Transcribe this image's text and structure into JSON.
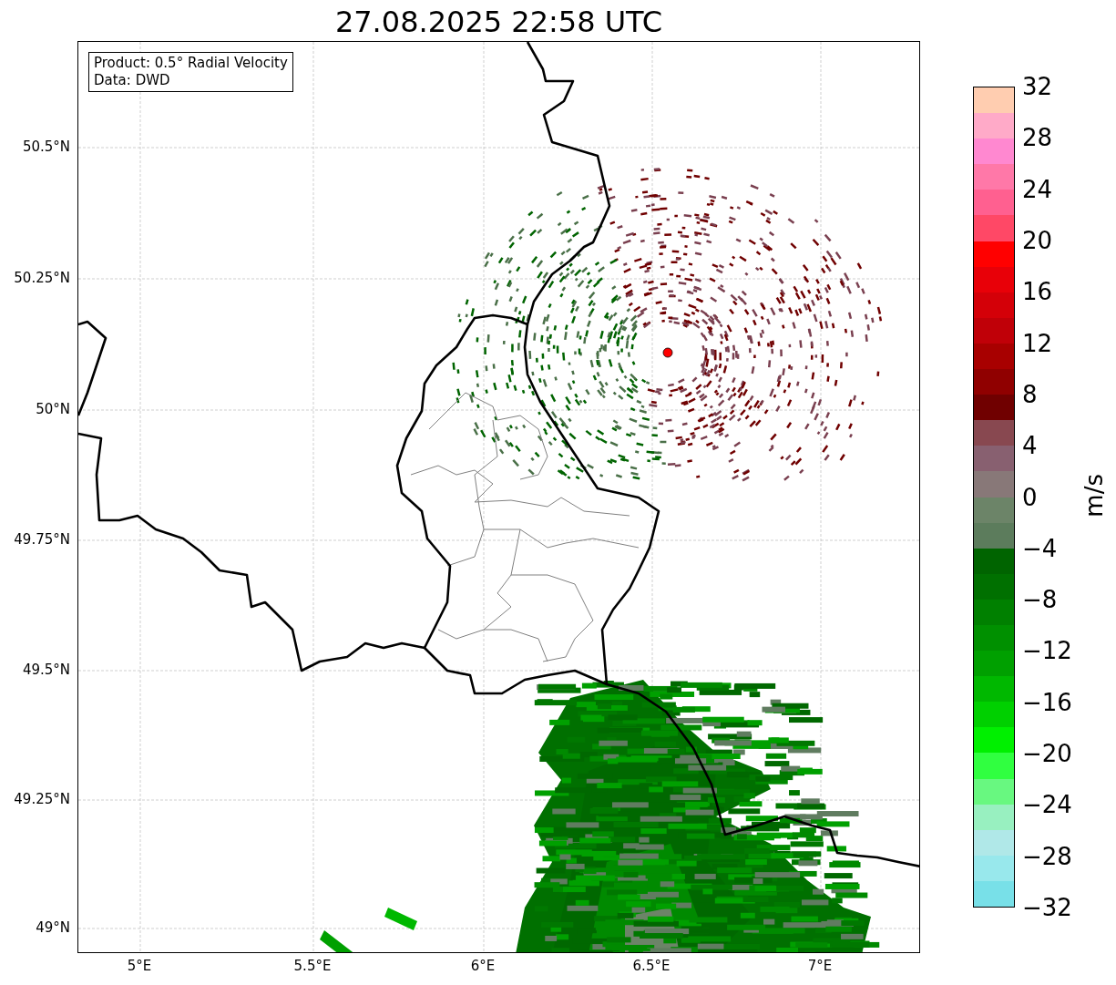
{
  "title": "27.08.2025 22:58 UTC",
  "info_box": {
    "lines": [
      "Product: 0.5° Radial Velocity",
      "Data: DWD"
    ]
  },
  "map": {
    "y_ticks": [
      "50.5°N",
      "50.25°N",
      "50°N",
      "49.75°N",
      "49.5°N",
      "49.25°N",
      "49°N"
    ],
    "x_ticks": [
      "5°E",
      "5.5°E",
      "6°E",
      "6.5°E",
      "7°E"
    ]
  },
  "colorbar": {
    "label": "m/s",
    "ticks": [
      "32",
      "28",
      "24",
      "20",
      "16",
      "12",
      "8",
      "4",
      "0",
      "−4",
      "−8",
      "−12",
      "−16",
      "−20",
      "−24",
      "−28",
      "−32"
    ],
    "bands": [
      {
        "color": "#ffcdb0"
      },
      {
        "color": "#ffaac8"
      },
      {
        "color": "#ff88d0"
      },
      {
        "color": "#ff78a8"
      },
      {
        "color": "#ff6090"
      },
      {
        "color": "#ff4866"
      },
      {
        "color": "#ff0000"
      },
      {
        "color": "#e80008"
      },
      {
        "color": "#d40008"
      },
      {
        "color": "#c00008"
      },
      {
        "color": "#a80000"
      },
      {
        "color": "#900000"
      },
      {
        "color": "#700000"
      },
      {
        "color": "#884850"
      },
      {
        "color": "#886070"
      },
      {
        "color": "#887878"
      },
      {
        "color": "#6c8468"
      },
      {
        "color": "#5c7c5c"
      },
      {
        "color": "#006400"
      },
      {
        "color": "#007000"
      },
      {
        "color": "#008000"
      },
      {
        "color": "#009000"
      },
      {
        "color": "#00a000"
      },
      {
        "color": "#00b800"
      },
      {
        "color": "#00d000"
      },
      {
        "color": "#00f000"
      },
      {
        "color": "#30ff40"
      },
      {
        "color": "#68f880"
      },
      {
        "color": "#98f0c0"
      },
      {
        "color": "#b0e8e8"
      },
      {
        "color": "#98e8ec"
      },
      {
        "color": "#78e0e8"
      }
    ]
  }
}
